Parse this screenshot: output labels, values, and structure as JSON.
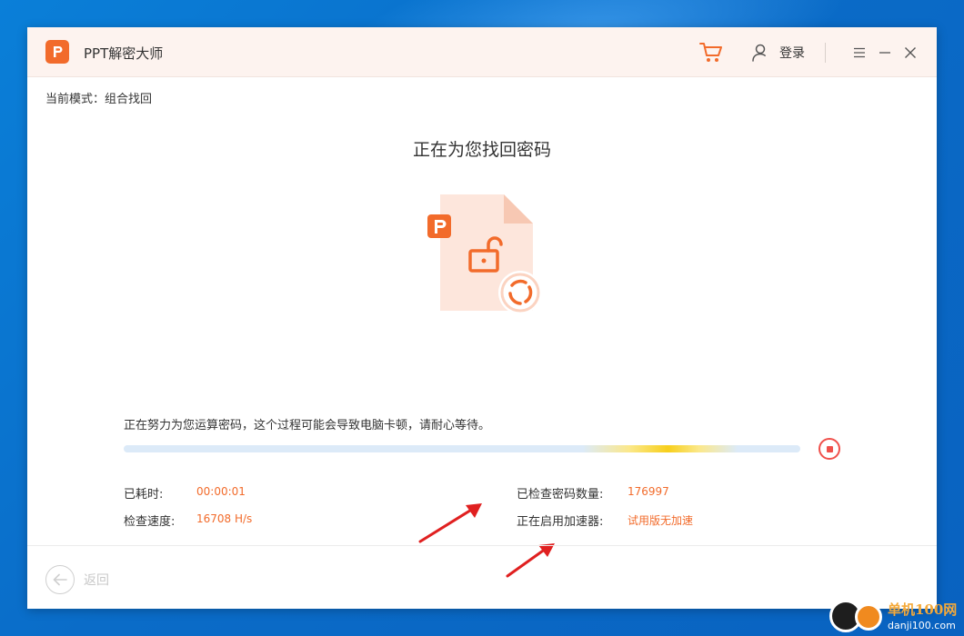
{
  "app": {
    "title": "PPT解密大师",
    "login_label": "登录"
  },
  "mode": {
    "text": "当前模式：组合找回"
  },
  "main": {
    "title": "正在为您找回密码",
    "hint": "正在努力为您运算密码，这个过程可能会导致电脑卡顿，请耐心等待。"
  },
  "stats": {
    "elapsed_label": "已耗时:",
    "elapsed_value": "00:00:01",
    "speed_label": "检查速度:",
    "speed_value": "16708 H/s",
    "checked_label": "已检查密码数量:",
    "checked_value": "176997",
    "accel_label": "正在启用加速器:",
    "accel_value": "试用版无加速"
  },
  "footer": {
    "back_label": "返回"
  },
  "watermark": {
    "site_name": "单机100网",
    "site_url": "danji100.com"
  },
  "colors": {
    "accent": "#f26b2b",
    "stop": "#f0504b",
    "progress_track": "#dceaf8",
    "progress_glow": "#f7cf1c",
    "annotation_arrow": "#e02020"
  }
}
